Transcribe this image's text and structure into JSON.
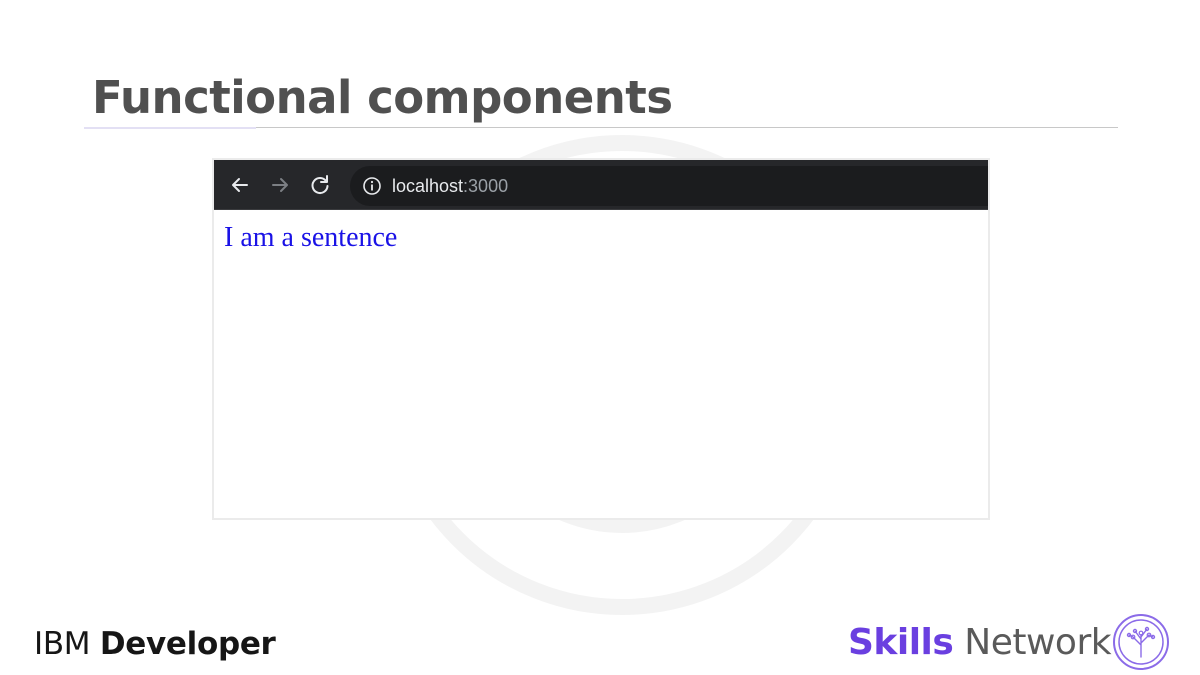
{
  "slide": {
    "title": "Functional components"
  },
  "browser": {
    "url_host": "localhost",
    "url_port": ":3000",
    "nav": {
      "back_icon": "arrow-left-icon",
      "forward_icon": "arrow-right-icon",
      "reload_icon": "reload-icon",
      "info_icon": "info-icon"
    },
    "page_text": "I am a sentence"
  },
  "footer": {
    "ibm_left": "IBM",
    "ibm_right": "Developer",
    "skills_left": "Skills",
    "skills_right": "Network"
  },
  "colors": {
    "toolbar": "#26272a",
    "sentence": "#1a12e6",
    "skills_accent": "#6a3fe0",
    "title": "#505050"
  }
}
